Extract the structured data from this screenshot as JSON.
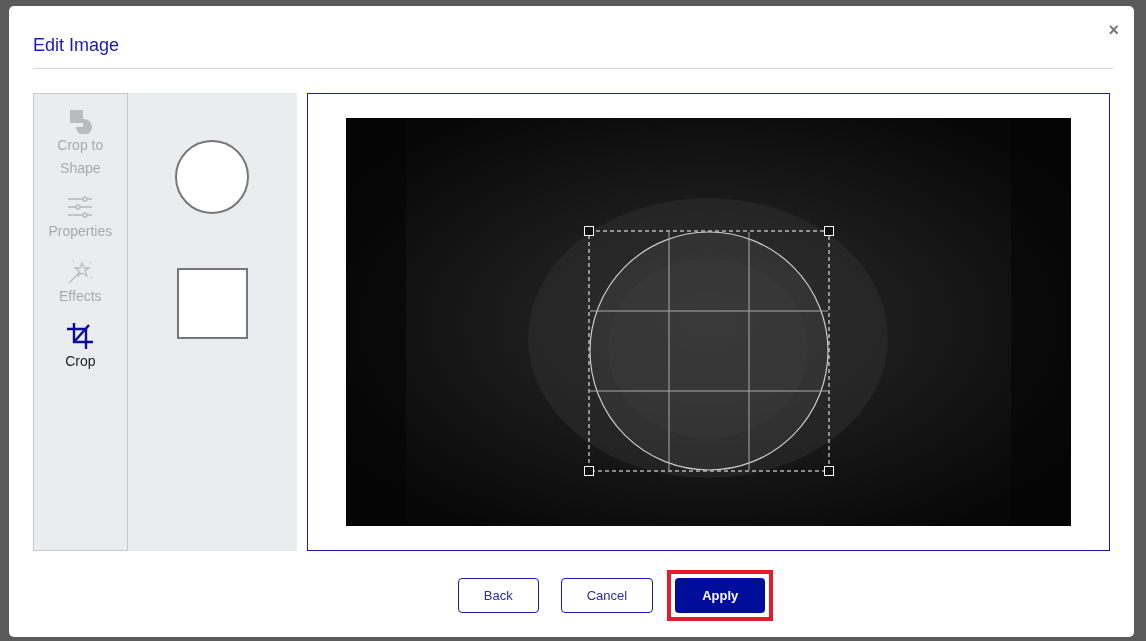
{
  "dialog": {
    "title": "Edit Image",
    "close": "×"
  },
  "tools": [
    {
      "label": "Crop to Shape",
      "selected": false
    },
    {
      "label": "Properties",
      "selected": false
    },
    {
      "label": "Effects",
      "selected": false
    },
    {
      "label": "Crop",
      "selected": true
    }
  ],
  "shapes": [
    {
      "kind": "circle"
    },
    {
      "kind": "square"
    }
  ],
  "buttons": [
    {
      "label": "Back",
      "primary": false,
      "highlighted": false
    },
    {
      "label": "Cancel",
      "primary": false,
      "highlighted": false
    },
    {
      "label": "Apply",
      "primary": true,
      "highlighted": true
    }
  ]
}
